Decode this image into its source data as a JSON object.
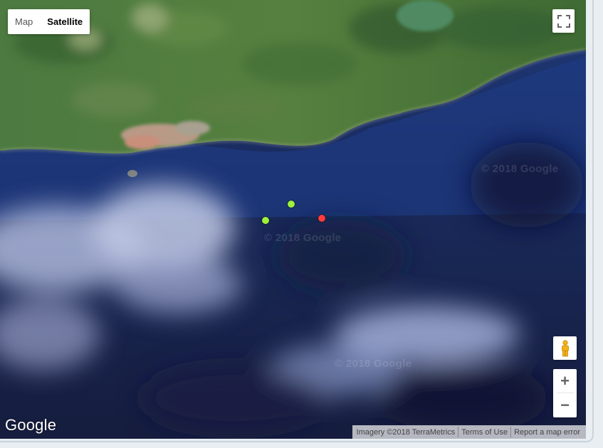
{
  "map_type_control": {
    "map_label": "Map",
    "satellite_label": "Satellite",
    "active": "Satellite"
  },
  "controls": {
    "fullscreen_icon": "fullscreen-icon",
    "street_view_icon": "pegman-icon",
    "zoom_in_label": "+",
    "zoom_out_label": "−"
  },
  "logo": "Google",
  "watermark": "© 2018 Google",
  "attribution": {
    "imagery": "Imagery ©2018 TerraMetrics",
    "terms": "Terms of Use",
    "report": "Report a map error"
  },
  "markers": [
    {
      "color": "#9ef03c",
      "status": "green"
    },
    {
      "color": "#9ef03c",
      "status": "green"
    },
    {
      "color": "#ff3b3b",
      "status": "red"
    }
  ],
  "colors": {
    "land": "#4f7a3e",
    "sea": "#1c2a58",
    "clouds": "#c8cfe8"
  }
}
